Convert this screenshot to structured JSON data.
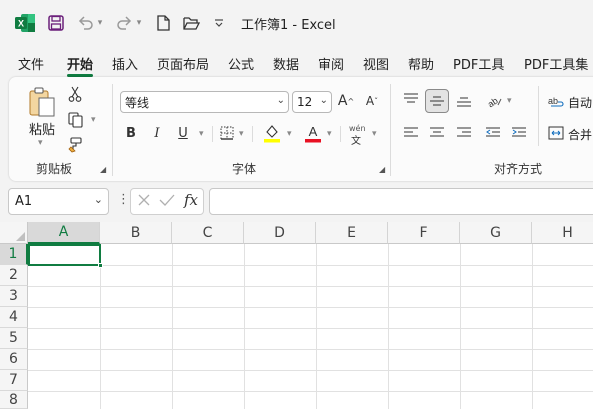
{
  "titlebar": {
    "title": "工作簿1  -  Excel",
    "icons": [
      "excel-logo-icon",
      "save-icon",
      "undo-icon",
      "redo-icon",
      "new-file-icon",
      "open-folder-icon",
      "customize-qat-icon"
    ]
  },
  "tabs": [
    {
      "label": "文件"
    },
    {
      "label": "开始",
      "active": true
    },
    {
      "label": "插入"
    },
    {
      "label": "页面布局"
    },
    {
      "label": "公式"
    },
    {
      "label": "数据"
    },
    {
      "label": "审阅"
    },
    {
      "label": "视图"
    },
    {
      "label": "帮助"
    },
    {
      "label": "PDF工具"
    },
    {
      "label": "PDF工具集"
    }
  ],
  "ribbon": {
    "clipboard": {
      "label": "剪贴板",
      "paste": "粘贴"
    },
    "font": {
      "label": "字体",
      "font_name": "等线",
      "font_size": "12",
      "phonetic": "wén",
      "phonetic_char": "文"
    },
    "alignment": {
      "label": "对齐方式",
      "wrap": "自动",
      "merge": "合并"
    }
  },
  "formula_bar": {
    "name_box": "A1",
    "fx": "fx",
    "formula": ""
  },
  "grid": {
    "columns": [
      "A",
      "B",
      "C",
      "D",
      "E",
      "F",
      "G",
      "H"
    ],
    "rows": [
      "1",
      "2",
      "3",
      "4",
      "5",
      "6",
      "7",
      "8"
    ],
    "selected_cell": "A1"
  },
  "colors": {
    "accent": "#107c41",
    "fill_highlight": "#ffff00",
    "font_color": "#e81123"
  }
}
